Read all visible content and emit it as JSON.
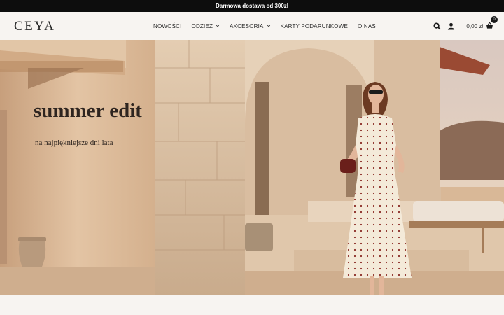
{
  "topbar": {
    "text": "Darmowa dostawa od 300zł"
  },
  "header": {
    "logo": "CEYA",
    "nav": [
      {
        "label": "NOWOŚCI",
        "dropdown": false
      },
      {
        "label": "ODZIEŻ",
        "dropdown": true
      },
      {
        "label": "AKCESORIA",
        "dropdown": true
      },
      {
        "label": "KARTY PODARUNKOWE",
        "dropdown": false
      },
      {
        "label": "O NAS",
        "dropdown": false
      }
    ],
    "cart_total": "0,00 zł",
    "cart_count": "0",
    "icons": [
      "search-icon",
      "user-icon",
      "basket-icon"
    ]
  },
  "hero": {
    "title": "summer edit",
    "subtitle": "na najpiękniejsze dni lata"
  },
  "colors": {
    "topbar_bg": "#0d0d0d",
    "header_bg": "#f7f4f1",
    "text_dark": "#2b2b2b"
  }
}
